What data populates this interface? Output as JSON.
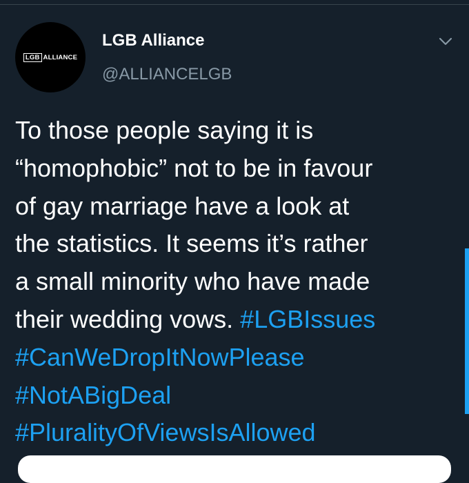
{
  "tweet": {
    "avatar": {
      "logo_box_text": "LGB",
      "logo_text": "ALLIANCE"
    },
    "display_name": "LGB Alliance",
    "handle": "@ALLIANCELGB",
    "menu_icon": "chevron-down-icon",
    "text_lines": [
      "To those people saying it is",
      "“homophobic” not to be in favour",
      "of gay marriage have a look at",
      "the statistics. It seems it’s rather",
      "a small minority who have made",
      "their wedding vows. "
    ],
    "hashtags": [
      "#LGBIssues",
      "#CanWeDropItNowPlease",
      "#NotABigDeal",
      "#PluralityOfViewsIsAllowed"
    ]
  },
  "colors": {
    "background": "#15202b",
    "text": "#ffffff",
    "secondary_text": "#8899a6",
    "link": "#1da1f2"
  }
}
